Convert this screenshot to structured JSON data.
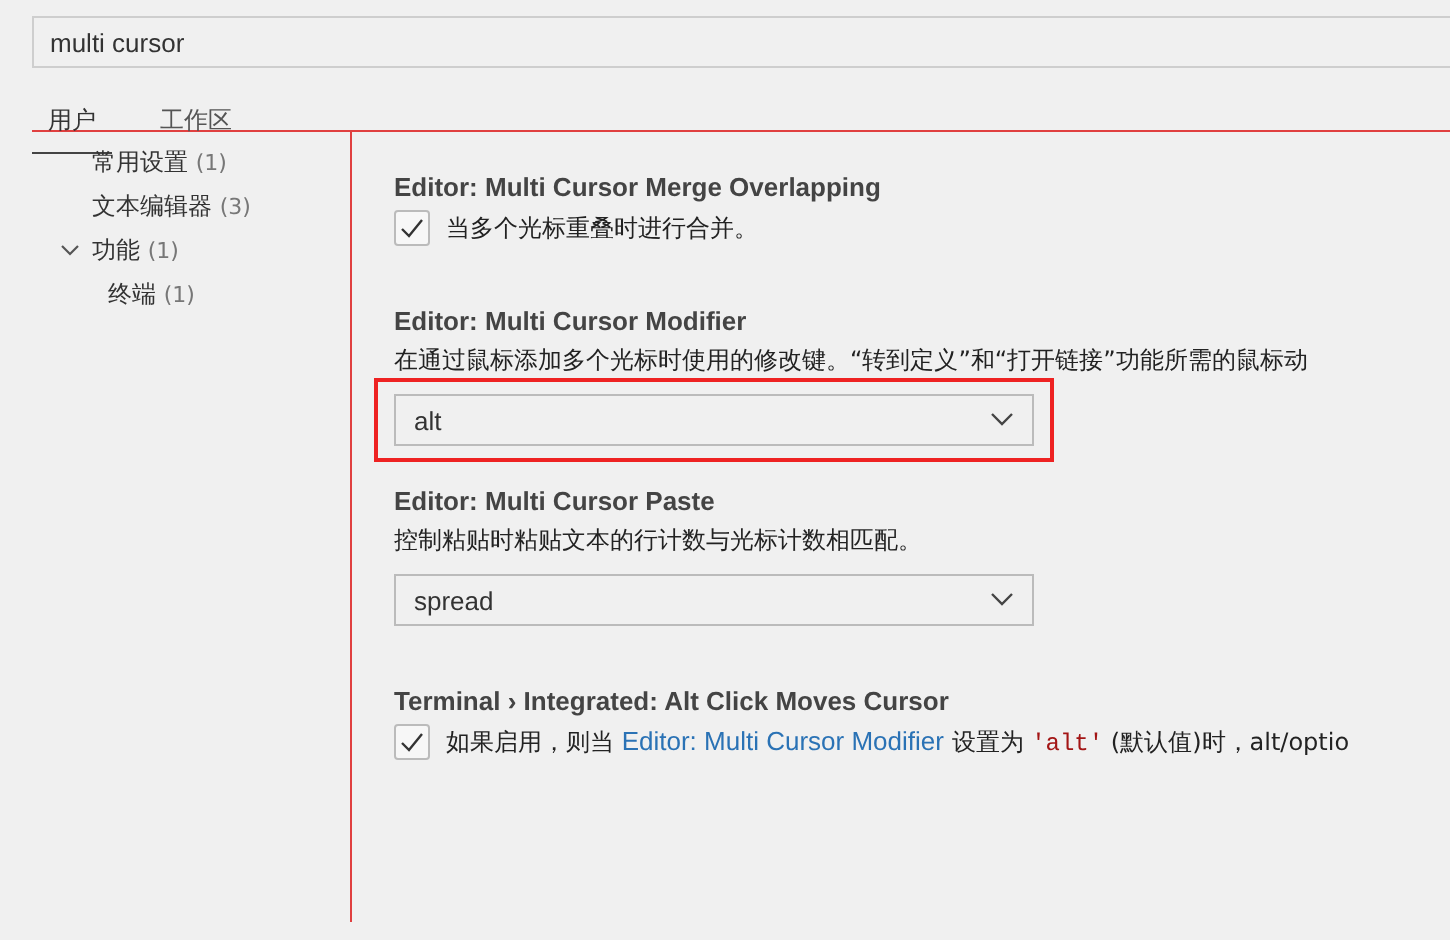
{
  "search": {
    "value": "multi cursor"
  },
  "tabs": [
    {
      "label": "用户",
      "selected": true
    },
    {
      "label": "工作区",
      "selected": false
    }
  ],
  "sidebar": {
    "items": [
      {
        "label": "常用设置",
        "count": "(1)"
      },
      {
        "label": "文本编辑器",
        "count": "(3)"
      },
      {
        "label": "功能",
        "count": "(1)",
        "expanded": true,
        "children": [
          {
            "label": "终端",
            "count": "(1)"
          }
        ]
      }
    ]
  },
  "settings": [
    {
      "kind": "checkbox",
      "title": "Editor: Multi Cursor Merge Overlapping",
      "checked": true,
      "parts": [
        {
          "text": "当多个光标重叠时进行合并。"
        }
      ]
    },
    {
      "kind": "dropdown",
      "title": "Editor: Multi Cursor Modifier",
      "description": "在通过鼠标添加多个光标时使用的修改键。“转到定义”和“打开链接”功能所需的鼠标动",
      "value": "alt",
      "highlighted": true
    },
    {
      "kind": "dropdown",
      "title": "Editor: Multi Cursor Paste",
      "description": "控制粘贴时粘贴文本的行计数与光标计数相匹配。",
      "value": "spread"
    },
    {
      "kind": "checkbox",
      "title": "Terminal › Integrated: Alt Click Moves Cursor",
      "checked": true,
      "parts": [
        {
          "text": "如果启用，则当 "
        },
        {
          "link": "Editor: Multi Cursor Modifier"
        },
        {
          "text": " 设置为 "
        },
        {
          "code": "'alt'"
        },
        {
          "text": " (默认值)时，alt/optio"
        }
      ]
    }
  ]
}
